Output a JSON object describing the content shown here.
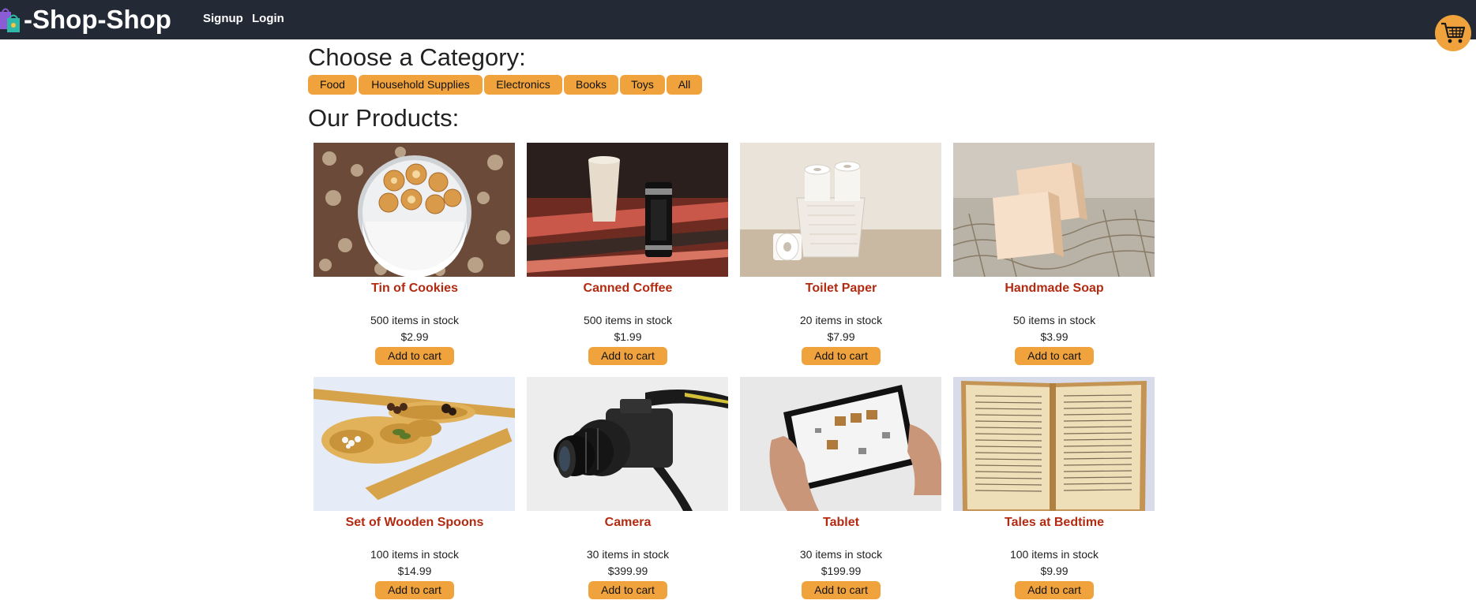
{
  "brand": {
    "name": "-Shop-Shop",
    "icon": "shopping-bags-icon"
  },
  "nav": {
    "signup": "Signup",
    "login": "Login"
  },
  "cart": {
    "icon": "shopping-cart-icon"
  },
  "categories": {
    "heading": "Choose a Category:",
    "items": [
      "Food",
      "Household Supplies",
      "Electronics",
      "Books",
      "Toys",
      "All"
    ]
  },
  "products": {
    "heading": "Our Products:",
    "add_label": "Add to cart",
    "items": [
      {
        "name": "Tin of Cookies",
        "stock": "500 items in stock",
        "price": "$2.99",
        "image": "cookies-image"
      },
      {
        "name": "Canned Coffee",
        "stock": "500 items in stock",
        "price": "$1.99",
        "image": "coffee-image"
      },
      {
        "name": "Toilet Paper",
        "stock": "20 items in stock",
        "price": "$7.99",
        "image": "toilet-paper-image"
      },
      {
        "name": "Handmade Soap",
        "stock": "50 items in stock",
        "price": "$3.99",
        "image": "soap-image"
      },
      {
        "name": "Set of Wooden Spoons",
        "stock": "100 items in stock",
        "price": "$14.99",
        "image": "wooden-spoons-image"
      },
      {
        "name": "Camera",
        "stock": "30 items in stock",
        "price": "$399.99",
        "image": "camera-image"
      },
      {
        "name": "Tablet",
        "stock": "30 items in stock",
        "price": "$199.99",
        "image": "tablet-image"
      },
      {
        "name": "Tales at Bedtime",
        "stock": "100 items in stock",
        "price": "$9.99",
        "image": "book-image"
      }
    ]
  },
  "colors": {
    "navbar": "#232a36",
    "accent": "#f0a33c",
    "product_name": "#b22a10"
  }
}
